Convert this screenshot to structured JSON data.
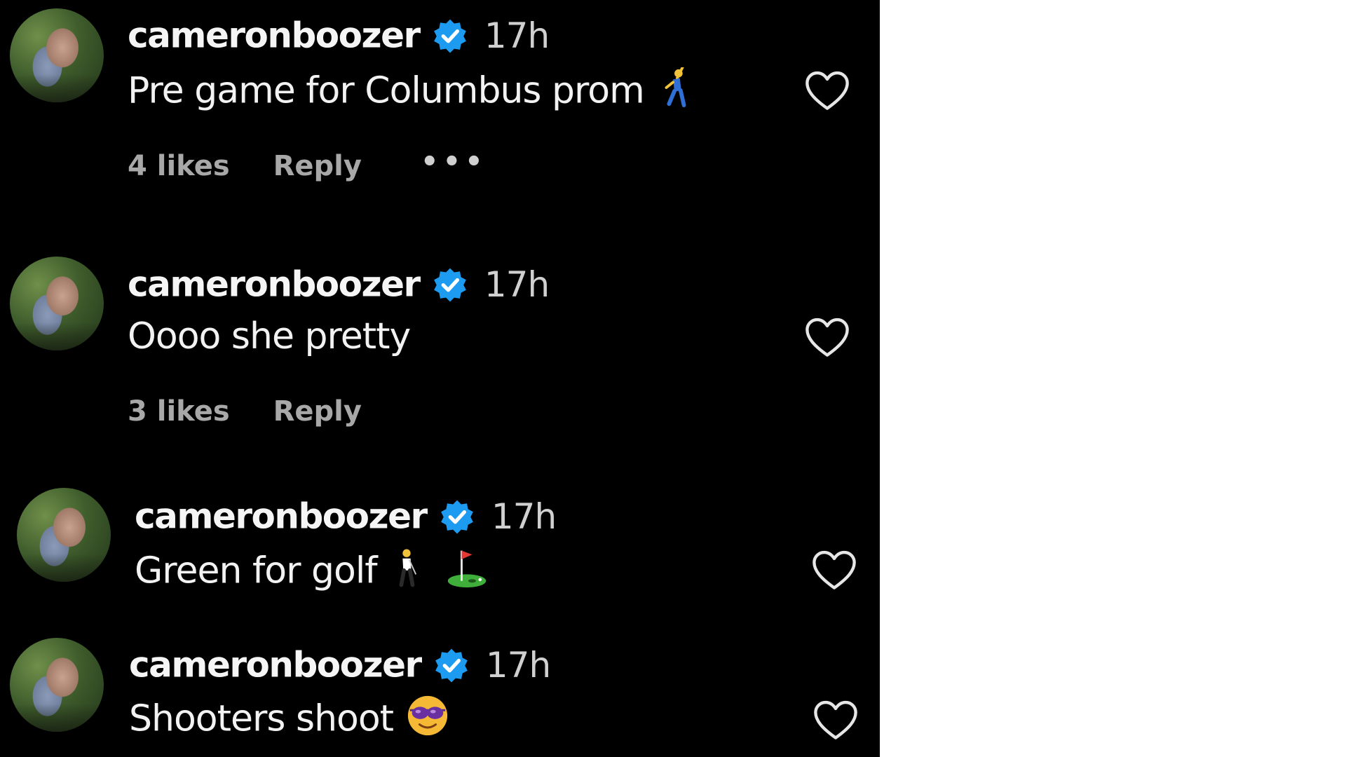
{
  "comments": [
    {
      "username": "cameronboozer",
      "time": "17h",
      "text": "Pre game for Columbus prom",
      "emoji": "dancer-emoji",
      "likes": "4 likes",
      "reply": "Reply",
      "more": "•••"
    },
    {
      "username": "cameronboozer",
      "time": "17h",
      "text": "Oooo she pretty",
      "likes": "3 likes",
      "reply": "Reply"
    },
    {
      "username": "cameronboozer",
      "time": "17h",
      "text": "Green for golf",
      "emoji": "golfer-emoji, flag-in-hole-emoji"
    },
    {
      "username": "cameronboozer",
      "time": "17h",
      "text": "Shooters shoot",
      "emoji": "sunglasses-face-emoji"
    }
  ],
  "colors": {
    "background": "#000000",
    "verified": "#1d9bf0",
    "username": "#f5f5f5",
    "meta": "#a8a8a8"
  }
}
